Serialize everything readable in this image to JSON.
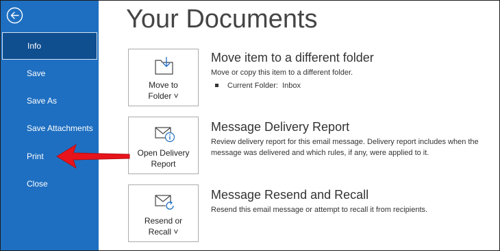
{
  "sidebar": {
    "back_icon": "back-arrow-circle-icon",
    "items": [
      {
        "label": "Info",
        "active": true
      },
      {
        "label": "Save"
      },
      {
        "label": "Save As"
      },
      {
        "label": "Save Attachments"
      },
      {
        "label": "Print"
      },
      {
        "label": "Close"
      }
    ],
    "colors": {
      "background": "#1e6fc1",
      "active": "#0f4e8f"
    }
  },
  "main": {
    "title": "Your Documents",
    "sections": [
      {
        "button_line1": "Move to",
        "button_line2": "Folder ˅",
        "icon": "move-to-folder-icon",
        "title": "Move item to a different folder",
        "description": "Move or copy this item to a different folder.",
        "bullet_label": "Current Folder:",
        "bullet_value": "Inbox"
      },
      {
        "button_line1": "Open Delivery",
        "button_line2": "Report",
        "icon": "delivery-report-envelope-icon",
        "title": "Message Delivery Report",
        "description": "Review delivery report for this email message. Delivery report includes when the message was delivered and which rules, if any, were applied to it."
      },
      {
        "button_line1": "Resend or",
        "button_line2": "Recall ˅",
        "icon": "resend-envelope-icon",
        "title": "Message Resend and Recall",
        "description": "Resend this email message or attempt to recall it from recipients."
      }
    ]
  },
  "annotation": {
    "arrow_color": "#e8141b",
    "points_to": "Print"
  }
}
